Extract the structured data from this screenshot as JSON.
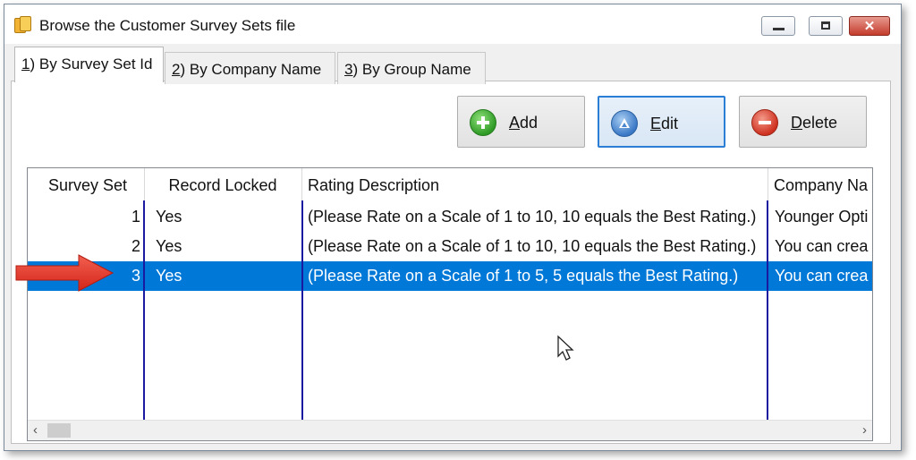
{
  "window": {
    "title": "Browse the Customer Survey Sets file"
  },
  "titlebar_buttons": {
    "minimize": "minimize",
    "maximize": "maximize",
    "close": "✕"
  },
  "tabs": [
    {
      "prefix": "1",
      "label": ") By Survey Set Id"
    },
    {
      "prefix": "2",
      "label": ") By Company Name"
    },
    {
      "prefix": "3",
      "label": ") By Group Name"
    }
  ],
  "buttons": {
    "add": {
      "accel": "A",
      "rest": "dd"
    },
    "edit": {
      "accel": "E",
      "rest": "dit"
    },
    "delete": {
      "accel": "D",
      "rest": "elete"
    }
  },
  "table": {
    "columns": [
      "Survey Set",
      "Record Locked",
      "Rating Description",
      "Company Na"
    ],
    "rows": [
      [
        "1",
        "Yes",
        "(Please Rate on a Scale of 1 to 10, 10 equals the Best Rating.)",
        "Younger Opti"
      ],
      [
        "2",
        "Yes",
        "(Please Rate on a Scale of 1 to 10, 10 equals the Best Rating.)",
        "You can crea"
      ],
      [
        "3",
        "Yes",
        "(Please Rate on a Scale of 1 to 5, 5 equals the Best Rating.)",
        "You can crea"
      ]
    ],
    "selected_row": 3
  },
  "scrollbar": {
    "left_arrow": "‹",
    "right_arrow": "›"
  },
  "colors": {
    "selection": "#0078d7",
    "column_separator": "#1a1aa0",
    "callout_arrow": "#e8352a"
  },
  "icons": [
    "app-icon",
    "add-icon",
    "edit-icon",
    "delete-icon",
    "callout-arrow-icon",
    "mouse-cursor-icon"
  ]
}
